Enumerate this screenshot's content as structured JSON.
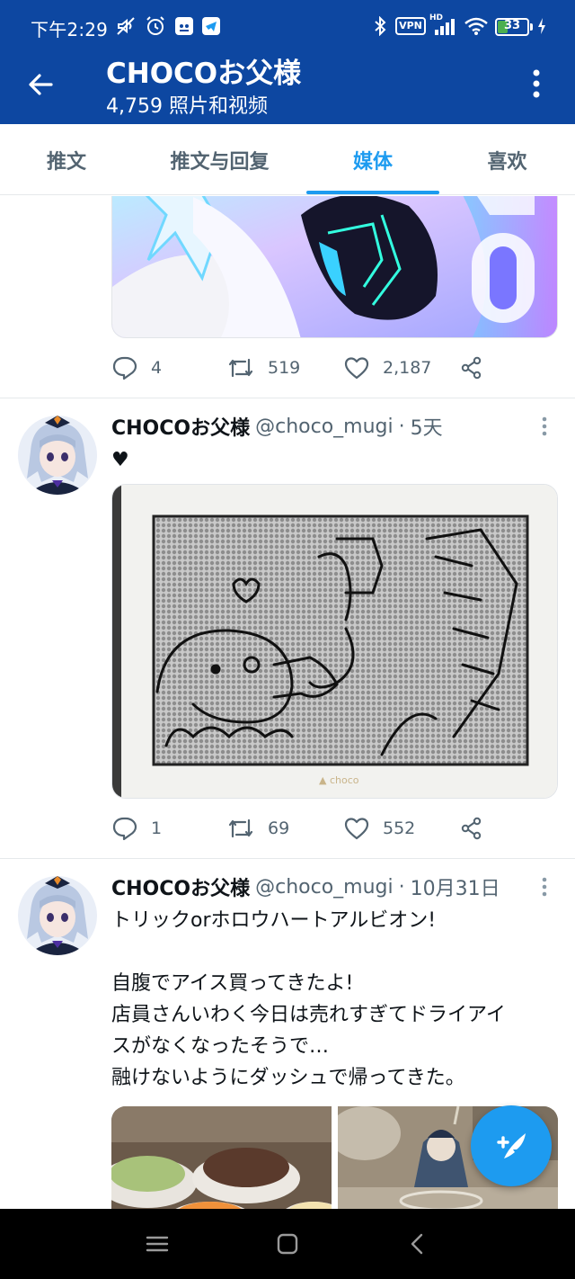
{
  "status_bar": {
    "time": "下午2:29",
    "battery": "33",
    "battery_level": 0.33,
    "battery_color": "#4caf50",
    "left_icons": [
      "mute-icon",
      "alarm-icon",
      "app-notification-icon",
      "telegram-icon"
    ],
    "right_icons": [
      "bluetooth-icon",
      "vpn-icon",
      "hd-signal-icon",
      "wifi-icon",
      "battery-icon",
      "charging-icon"
    ],
    "vpn_label": "VPN",
    "hd_label": "HD"
  },
  "header": {
    "title": "CHOCOお父様",
    "subtitle": "4,759 照片和视频",
    "color": "#0d47a1"
  },
  "tabs": [
    {
      "label": "推文",
      "active": false
    },
    {
      "label": "推文与回复",
      "active": false
    },
    {
      "label": "媒体",
      "active": true
    },
    {
      "label": "喜欢",
      "active": false
    }
  ],
  "accent": "#1d9bf0",
  "tweets": [
    {
      "partial": true,
      "media": [
        "anime-artwork-image"
      ],
      "stats": {
        "replies": "4",
        "retweets": "519",
        "likes": "2,187"
      }
    },
    {
      "name": "CHOCOお父様",
      "handle": "@choco_mugi",
      "dot": "·",
      "time": "5天",
      "text": "♥",
      "media": [
        "sketch-board-image"
      ],
      "stats": {
        "replies": "1",
        "retweets": "69",
        "likes": "552"
      }
    },
    {
      "name": "CHOCOお父様",
      "handle": "@choco_mugi",
      "dot": "·",
      "time": "10月31日",
      "text_lines": [
        "トリックorホロウハートアルビオン!",
        "",
        "自腹でアイス買ってきたよ!",
        "店員さんいわく今日は売れすぎてドライアイ",
        "スがなくなったそうで…",
        "融けないようにダッシュで帰ってきた。"
      ],
      "media": [
        "ice-cream-photo",
        "acrylic-figure-photo"
      ]
    }
  ],
  "fab_icon": "compose-icon",
  "nav_icons": [
    "menu-icon",
    "home-icon",
    "back-icon"
  ]
}
